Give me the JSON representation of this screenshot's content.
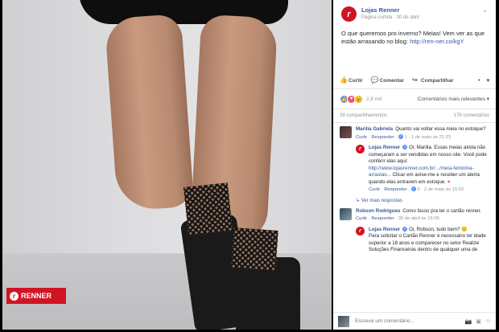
{
  "photo": {
    "brand_text": "RENNER",
    "brand_color": "#d11424"
  },
  "post": {
    "page_name": "Lojas Renner",
    "page_type": "Página curtida",
    "date": "30 de abril",
    "text": "O que queremos pro inverno? Meias! Vem ver as que estão arrasando no blog: ",
    "link": "http://ren-ner.co/kgY",
    "actions": {
      "like": "Curtir",
      "comment": "Comentar",
      "share": "Compartilhar"
    },
    "reactions_count": "2,8 mil",
    "sort": "Comentários mais relevantes",
    "shares": "39 compartilhamentos",
    "comments_count": "176 comentários"
  },
  "comments": [
    {
      "author": "Marilia Gabriela",
      "text": "Quanto vai voltar essa meia no estoque?",
      "like": "Curtir",
      "reply": "Responder",
      "likes": "1",
      "date": "1 de maio às 21:23"
    },
    {
      "author": "Lojas Renner",
      "text_a": "Oi, Marilia. Essas meias ainda não começaram a ser vendidas em nosso site. Você pode conferir elas aqui: ",
      "link": "http://www.lojasrenner.com.br/.../meia-feminina-arrastao...",
      "text_b": " Clicar em avise-me e receber um alerta quando elas entrarem em estoque.",
      "like": "Curtir",
      "reply": "Responder",
      "likes": "5",
      "date": "2 de maio às 15:02",
      "more_replies": "Ver mais respostas"
    },
    {
      "author": "Robson Rodrigues",
      "text": "Como fasso pra ter o cartão renner.",
      "like": "Curtir",
      "reply": "Responder",
      "date": "30 de abril às 16:05"
    },
    {
      "author": "Lojas Renner",
      "text_a": "Oi, Robson, tudo bem? ",
      "text_b": "Para solicitar o Cartão Renner é necessário ter idade superior a 18 anos e comparecer no setor Realize Soluções Financeiras dentro de qualquer uma de"
    }
  ],
  "composer": {
    "placeholder": "Escreva um comentário..."
  }
}
